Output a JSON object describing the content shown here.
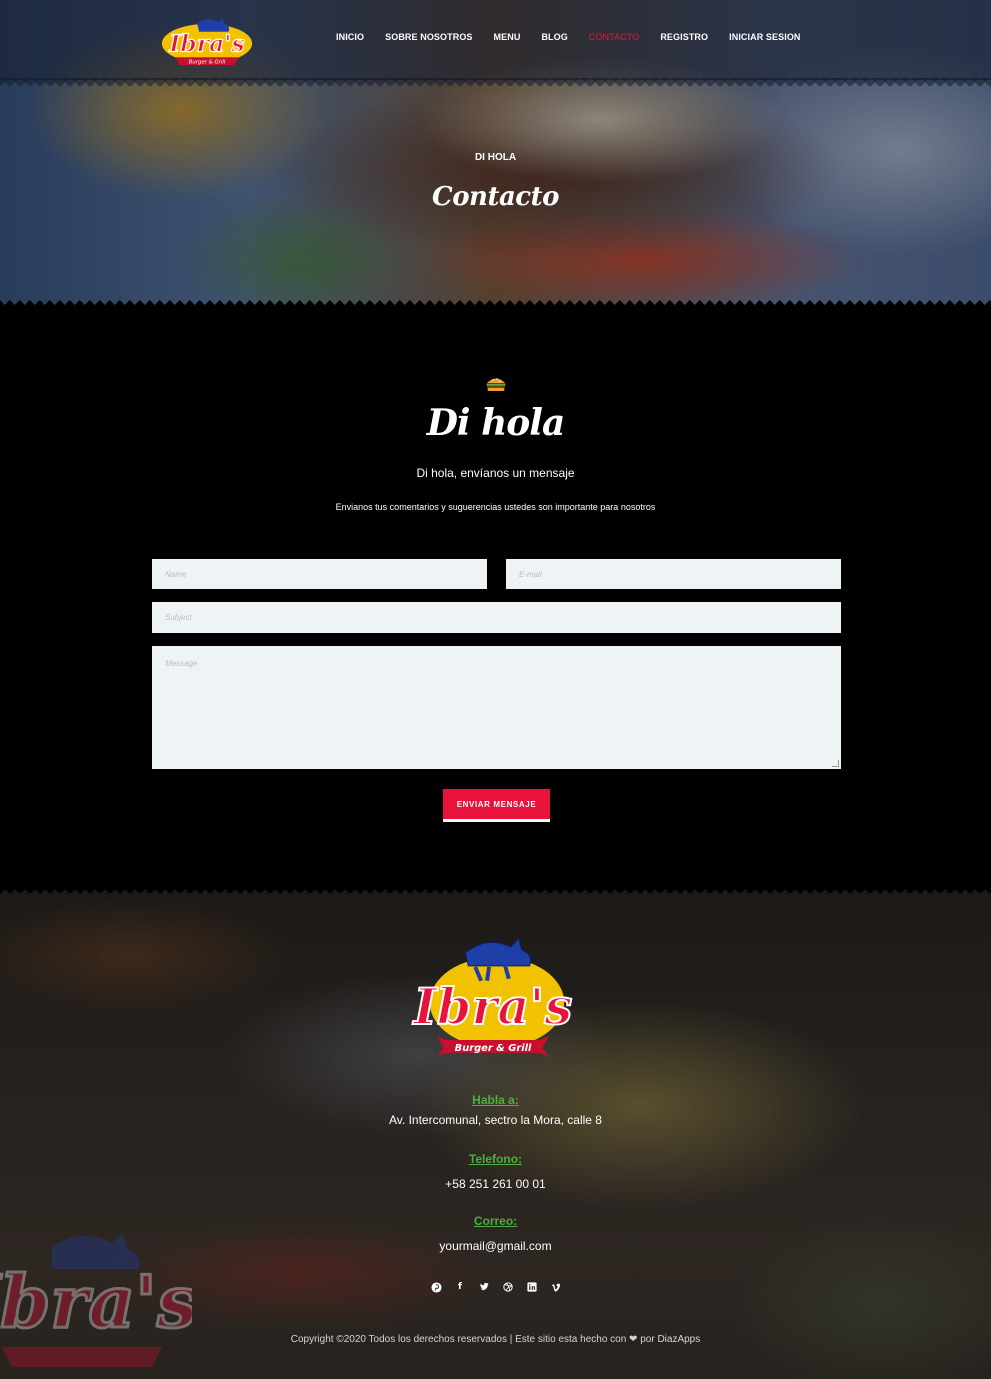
{
  "brand": {
    "logo_text": "Ibra's",
    "logo_tagline": "Burger & Grill",
    "colors": {
      "accent": "#e8123c",
      "label_green": "#4caf3f",
      "logo_blue": "#1e3fa8"
    }
  },
  "nav": {
    "items": [
      {
        "label": "INICIO",
        "active": false
      },
      {
        "label": "SOBRE NOSOTROS",
        "active": false
      },
      {
        "label": "MENU",
        "active": false
      },
      {
        "label": "BLOG",
        "active": false
      },
      {
        "label": "CONTACTO",
        "active": true
      },
      {
        "label": "REGISTRO",
        "active": false
      },
      {
        "label": "INICIAR SESION",
        "active": false
      }
    ]
  },
  "hero": {
    "eyebrow": "DI HOLA",
    "title": "Contacto"
  },
  "contact": {
    "icon": "burger-icon",
    "title": "Di hola",
    "subtitle": "Di hola, envíanos un mensaje",
    "description": "Envianos tus comentarios y suguerencias ustedes son importante para nosotros",
    "form": {
      "name_placeholder": "Name",
      "email_placeholder": "E-mail",
      "subject_placeholder": "Subject",
      "message_placeholder": "Message",
      "submit_label": "ENVIAR MENSAJE"
    }
  },
  "footer": {
    "address_label": "Habla a:",
    "address": "Av. Intercomunal, sectro la Mora, calle 8",
    "phone_label": "Telefono:",
    "phone": "+58 251 261 00 01",
    "email_label": "Correo:",
    "email": "yourmail@gmail.com",
    "social": [
      "pinterest-icon",
      "facebook-icon",
      "twitter-icon",
      "dribbble-icon",
      "linkedin-icon",
      "vimeo-icon"
    ],
    "copyright": "Copyright ©2020 Todos los derechos reservados | Este sitio esta hecho con ❤ por DiazApps"
  }
}
